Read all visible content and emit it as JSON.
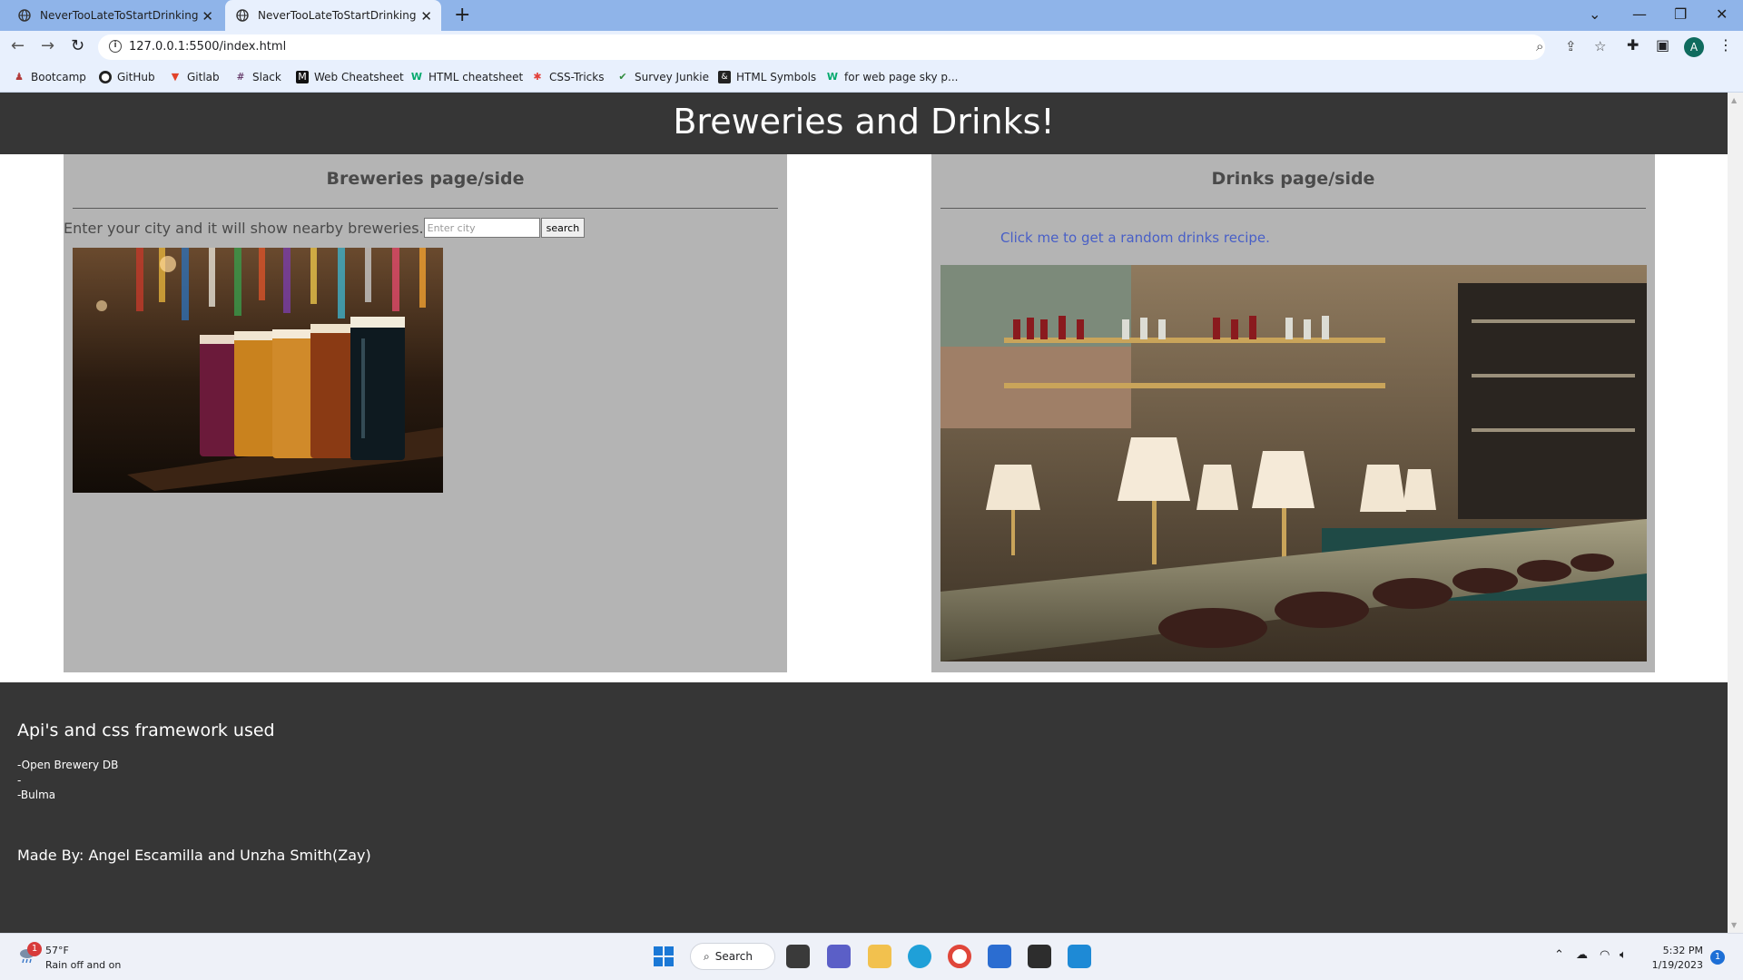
{
  "browser": {
    "tabs": [
      {
        "title": "NeverTooLateToStartDrinking",
        "active": false
      },
      {
        "title": "NeverTooLateToStartDrinking",
        "active": true
      }
    ],
    "url": "127.0.0.1:5500/index.html",
    "profile_initial": "A",
    "bookmarks": [
      {
        "label": "Bootcamp",
        "icon": "bootcamp-icon"
      },
      {
        "label": "GitHub",
        "icon": "github-icon"
      },
      {
        "label": "Gitlab",
        "icon": "gitlab-icon"
      },
      {
        "label": "Slack",
        "icon": "slack-icon"
      },
      {
        "label": "Web Cheatsheet",
        "icon": "medium-icon"
      },
      {
        "label": "HTML cheatsheet",
        "icon": "w-icon"
      },
      {
        "label": "CSS-Tricks",
        "icon": "css-tricks-icon"
      },
      {
        "label": "Survey Junkie",
        "icon": "check-icon"
      },
      {
        "label": "HTML Symbols",
        "icon": "symbols-icon"
      },
      {
        "label": "for web page sky p...",
        "icon": "w-icon"
      }
    ]
  },
  "page": {
    "hero_title": "Breweries and Drinks!",
    "breweries": {
      "title": "Breweries page/side",
      "prompt": "Enter your city and it will show nearby breweries.",
      "input_placeholder": "Enter city",
      "input_value": "",
      "button_label": "search"
    },
    "drinks": {
      "title": "Drinks page/side",
      "link_text": "Click me to get a random drinks recipe."
    },
    "footer": {
      "title": "Api's and css framework used",
      "items": [
        "-Open Brewery DB",
        "-",
        "-Bulma"
      ],
      "credit": "Made By: Angel Escamilla and Unzha Smith(Zay)"
    }
  },
  "taskbar": {
    "weather_temp": "57°F",
    "weather_desc": "Rain off and on",
    "weather_badge": "1",
    "search_label": "Search",
    "time": "5:32 PM",
    "date": "1/19/2023",
    "notification_count": "1"
  },
  "colors": {
    "hero_bg": "#363636",
    "panel_bg": "#b4b4b4",
    "link": "#485fc7",
    "tabbar": "#8fb4e9"
  }
}
